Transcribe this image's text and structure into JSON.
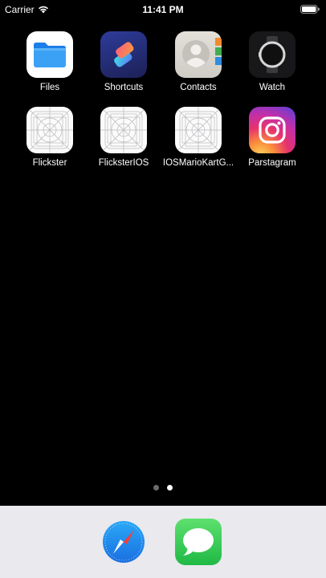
{
  "status_bar": {
    "carrier": "Carrier",
    "time": "11:41 PM",
    "icons": [
      "wifi-icon",
      "battery-icon"
    ]
  },
  "apps": [
    {
      "label": "Files",
      "icon": "files-folder-icon",
      "color": "#1e88f0"
    },
    {
      "label": "Shortcuts",
      "icon": "shortcuts-icon",
      "color": "#2d3b8f"
    },
    {
      "label": "Contacts",
      "icon": "contacts-icon",
      "color": "#d9d6cf"
    },
    {
      "label": "Watch",
      "icon": "watch-icon",
      "color": "#1c1c1e"
    },
    {
      "label": "Flickster",
      "icon": "placeholder-app-icon"
    },
    {
      "label": "FlicksterIOS",
      "icon": "placeholder-app-icon"
    },
    {
      "label": "IOSMarioKartG...",
      "icon": "placeholder-app-icon"
    },
    {
      "label": "Parstagram",
      "icon": "instagram-camera-icon"
    }
  ],
  "page_indicator": {
    "count": 2,
    "active_index": 1
  },
  "dock": {
    "apps": [
      {
        "icon": "safari-compass-icon",
        "color": "#1a8cf0"
      },
      {
        "icon": "messages-bubble-icon",
        "color": "#34c759"
      }
    ]
  }
}
